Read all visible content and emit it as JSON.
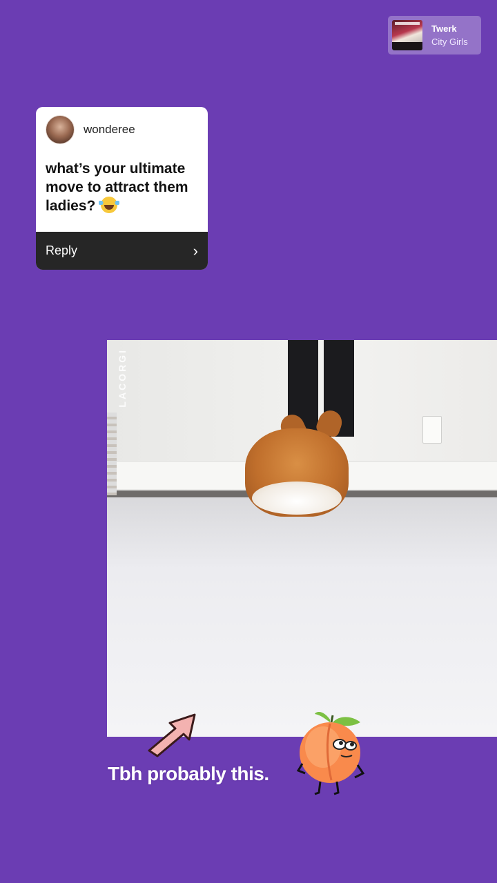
{
  "music": {
    "title": "Twerk",
    "artist": "City Girls",
    "icon": "album-art"
  },
  "question_card": {
    "username": "wonderee",
    "question": "what’s your ultimate move to attract them ladies?",
    "emoji": "face-with-tears-of-joy",
    "reply_label": "Reply",
    "reply_icon": "chevron-right-icon"
  },
  "video": {
    "watermark": "LACORGI"
  },
  "caption": "Tbh probably this.",
  "stickers": [
    "arrow-sticker",
    "peach-sticker"
  ],
  "colors": {
    "background": "#6b3db3",
    "card": "#ffffff",
    "reply_bar": "#262626"
  }
}
